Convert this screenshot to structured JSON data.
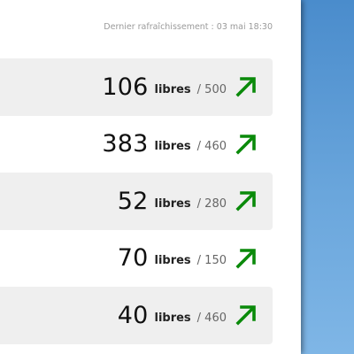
{
  "header": {
    "last_refresh": "Dernier rafraîchissement : 03 mai 18:30"
  },
  "colors": {
    "trend_up": "#0a8a0a"
  },
  "stations": [
    {
      "free": "106",
      "unit": "libres",
      "total": "/ 500",
      "trend": "arrow-up-right-icon"
    },
    {
      "free": "383",
      "unit": "libres",
      "total": "/ 460",
      "trend": "arrow-up-right-icon"
    },
    {
      "free": "52",
      "unit": "libres",
      "total": "/ 280",
      "trend": "arrow-up-right-icon"
    },
    {
      "free": "70",
      "unit": "libres",
      "total": "/ 150",
      "trend": "arrow-up-right-icon"
    },
    {
      "free": "40",
      "unit": "libres",
      "total": "/ 460",
      "trend": "arrow-up-right-icon"
    }
  ]
}
